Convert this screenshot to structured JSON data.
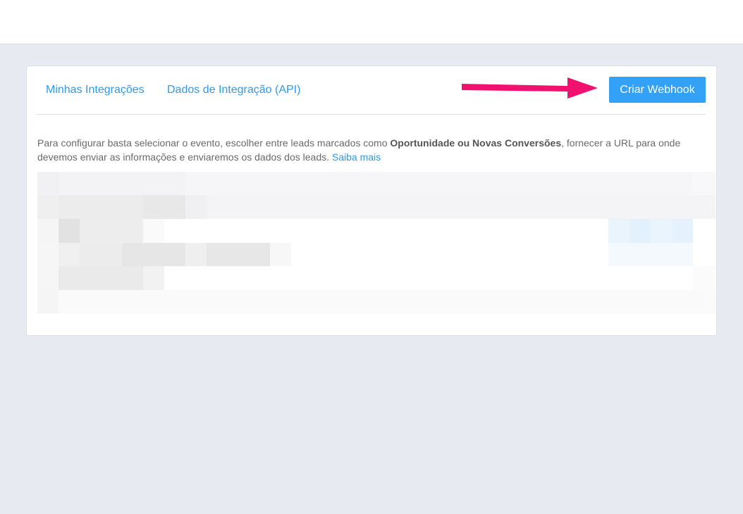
{
  "tabs": [
    {
      "label": "Minhas Integrações"
    },
    {
      "label": "Dados de Integração (API)"
    }
  ],
  "create_button": {
    "label": "Criar Webhook"
  },
  "description": {
    "part1": "Para configurar basta selecionar o evento, escolher entre leads marcados como ",
    "bold": "Oportunidade ou Novas Conversões",
    "part2": ", fornecer a URL para onde devemos enviar as informações e enviaremos os dados dos leads. ",
    "link": "Saiba mais"
  },
  "colors": {
    "accent": "#33a1f5",
    "link": "#2f9bea",
    "annotation_arrow": "#f0126e",
    "background": "#e8eaf1"
  },
  "icons": {
    "annotation": "arrow-right-icon"
  }
}
